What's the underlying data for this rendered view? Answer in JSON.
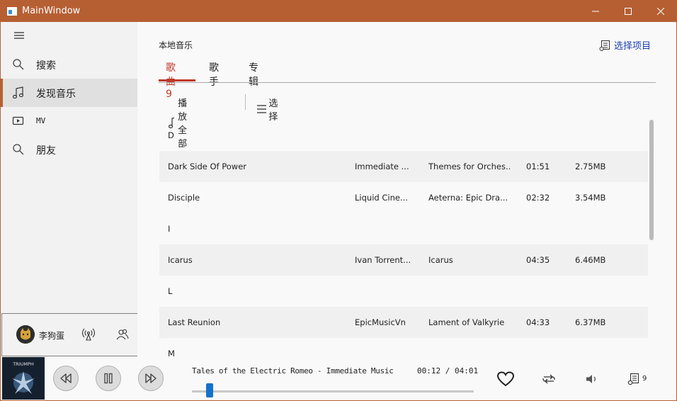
{
  "window": {
    "title": "MainWindow"
  },
  "sidebar": {
    "items": [
      {
        "label": "搜索",
        "icon": "search-icon"
      },
      {
        "label": "发现音乐",
        "icon": "music-note-icon"
      },
      {
        "label": "MV",
        "icon": "video-icon"
      },
      {
        "label": "朋友",
        "icon": "search-icon"
      }
    ],
    "user": {
      "name": "李狗蛋"
    }
  },
  "main": {
    "title": "本地音乐",
    "select_items": "选择项目",
    "tabs": [
      {
        "label": "歌曲9"
      },
      {
        "label": "歌手"
      },
      {
        "label": "专辑"
      }
    ],
    "toolbar": {
      "play_all": "播放全部",
      "select": "选择"
    }
  },
  "songs": {
    "groups": [
      "D",
      "I",
      "L",
      "M"
    ],
    "rows": [
      {
        "title": "Dark Side Of Power",
        "artist": "Immediate ...",
        "album": "Themes for Orches...",
        "duration": "01:51",
        "size": "2.75MB"
      },
      {
        "title": "Disciple",
        "artist": "Liquid Cine...",
        "album": "Aeterna: Epic Dra...",
        "duration": "02:32",
        "size": "3.54MB"
      },
      {
        "title": "Icarus",
        "artist": "Ivan Torrent...",
        "album": "Icarus",
        "duration": "04:35",
        "size": "6.46MB"
      },
      {
        "title": "Last Reunion",
        "artist": "EpicMusicVn",
        "album": "Lament of Valkyrie",
        "duration": "04:33",
        "size": "6.37MB"
      }
    ]
  },
  "player": {
    "now_playing": "Tales of the Electric Romeo - Immediate Music",
    "time": "00:12 / 04:01",
    "progress": 0.05,
    "playlist_count": "9",
    "cover_text": "TRIUMPH"
  },
  "colors": {
    "accent": "#b65f33",
    "tab_active": "#c0392b",
    "progress": "#1672c9"
  }
}
